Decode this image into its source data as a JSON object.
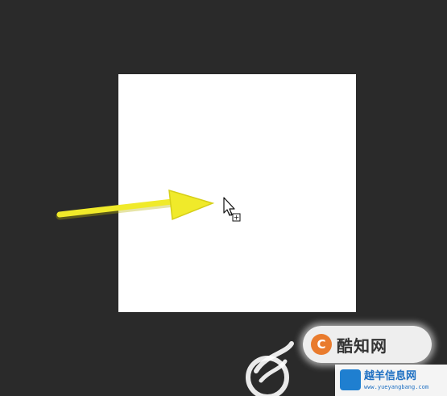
{
  "canvas": {
    "background_color": "#2a2a2a",
    "document_color": "#ffffff"
  },
  "annotation": {
    "arrow_color": "#f0ea2a",
    "arrow_icon": "arrow-right-icon"
  },
  "cursor": {
    "icon": "copy-cursor-icon",
    "plus_glyph": "+"
  },
  "watermark": {
    "badge_logo_glyph": "C",
    "badge_text": "酷知网",
    "bar_title": "越羊信息网",
    "bar_url": "www.yueyangbang.com",
    "swirl_icon": "swirl-logo-icon"
  }
}
